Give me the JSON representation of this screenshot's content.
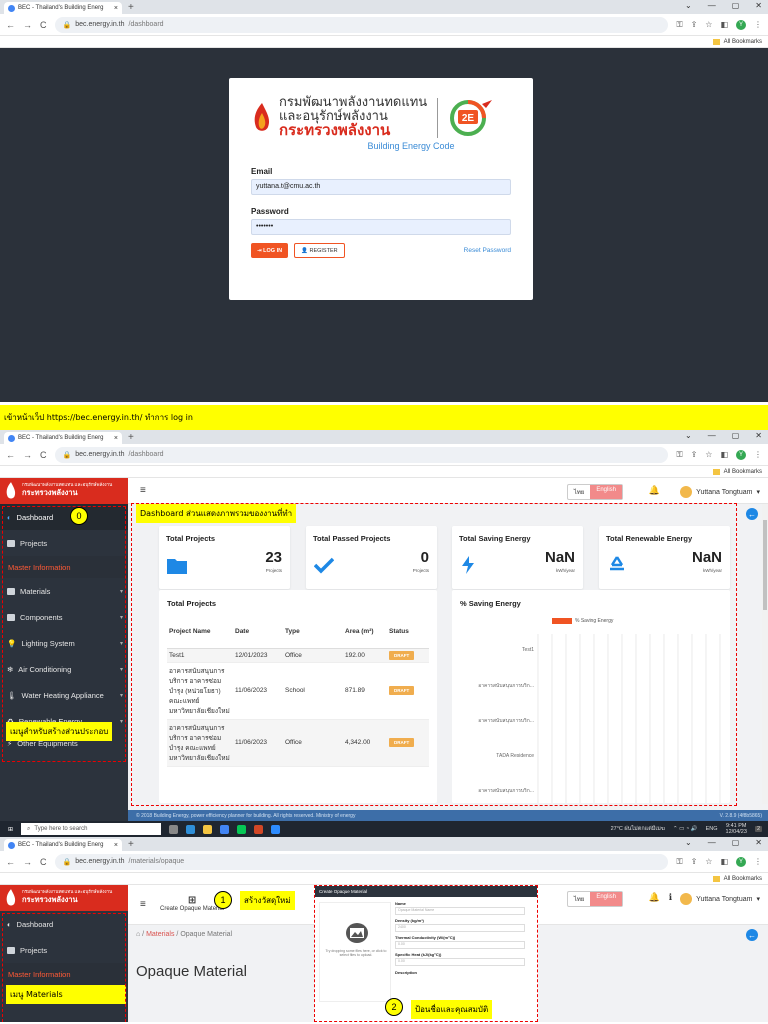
{
  "browser": {
    "tab_title": "BEC - Thailand's Building Energ",
    "tab_close": "×",
    "new_tab": "+",
    "win_controls": [
      "⌄",
      "—",
      "▢",
      "✕"
    ],
    "nav": [
      "←",
      "→",
      "C"
    ],
    "bookmarks": "All Bookmarks",
    "profile_letter": "Y"
  },
  "screen1": {
    "url_host": "bec.energy.in.th",
    "url_path": "/dashboard",
    "logo_line1": "กรมพัฒนาพลังงานทดแทน",
    "logo_line2": "และอนุรักษ์พลังงาน",
    "logo_line3": "กระทรวงพลังงาน",
    "badge": "2E",
    "app_name": "Building Energy Code",
    "email_label": "Email",
    "email_value": "yuttana.t@cmu.ac.th",
    "password_label": "Password",
    "password_value": "•••••••",
    "login_button": "LOG IN",
    "register_button": "REGISTER",
    "reset_link": "Reset Password"
  },
  "caption1": "เข้าหน้าเว็ป https://bec.energy.in.th/ ทำการ log in",
  "screen2": {
    "url_host": "bec.energy.in.th",
    "url_path": "/dashboard",
    "sidebar_logo_small": "กรมพัฒนาพลังงานทดแทน และอนุรักษ์พลังงาน",
    "sidebar_logo_big": "กระทรวงพลังงาน",
    "menu": [
      {
        "label": "Dashboard"
      },
      {
        "label": "Projects"
      },
      {
        "label": "Master Information"
      },
      {
        "label": "Materials"
      },
      {
        "label": "Components"
      },
      {
        "label": "Lighting System"
      },
      {
        "label": "Air Conditioning"
      },
      {
        "label": "Water Heating Appliance"
      },
      {
        "label": "Renewable Energy"
      },
      {
        "label": "Other Equipments"
      }
    ],
    "step_badge": "0",
    "sidebar_note": "เมนูสำหรับสร้างส่วนประกอบ",
    "lang_th": "ไทย",
    "lang_en": "English",
    "user_name": "Yuttana Tongtuam",
    "dashboard_note": "Dashboard ส่วนแสดงภาพรวมของงานที่ทำ",
    "stats": [
      {
        "title": "Total Projects",
        "value": "23",
        "unit": "Projects"
      },
      {
        "title": "Total Passed Projects",
        "value": "0",
        "unit": "Projects"
      },
      {
        "title": "Total Saving Energy",
        "value": "NaN",
        "unit": "kWh/year"
      },
      {
        "title": "Total Renewable Energy",
        "value": "NaN",
        "unit": "kWh/year"
      }
    ],
    "projects_title": "Total Projects",
    "table_headers": [
      "Project Name",
      "Date",
      "Type",
      "Area (m²)",
      "Status"
    ],
    "rows": [
      {
        "name": "Test1",
        "date": "12/01/2023",
        "type": "Office",
        "area": "192.00",
        "status": "DRAFT"
      },
      {
        "name": "อาคารสนับสนุนการบริการ อาคารซ่อมบำรุง (หน่วยโยธา) คณะแพทย์ มหาวิทยาลัยเชียงใหม่",
        "date": "11/06/2023",
        "type": "School",
        "area": "871.89",
        "status": "DRAFT"
      },
      {
        "name": "อาคารสนับสนุนการบริการ อาคารซ่อมบำรุง คณะแพทย์ มหาวิทยาลัยเชียงใหม่",
        "date": "11/06/2023",
        "type": "Office",
        "area": "4,342.00",
        "status": "DRAFT"
      }
    ],
    "saving_title": "% Saving Energy",
    "legend": "% Saving Energy",
    "chart_labels": [
      "Test1",
      "อาคารสนับสนุนการบริก...",
      "อาคารสนับสนุนการบริก...",
      "TADA Residence",
      "อาคารสนับสนุนการบริก..."
    ],
    "footer": "© 2018 Building Energy, power efficiency planner for building. All rights reserved. Ministry of energy",
    "version": "V. 2.8.9 (4f8b5865)",
    "taskbar_search": "Type here to search",
    "weather": "27°C ฝนไม่ตกแต่มีเมฆ",
    "lang_tb": "ENG",
    "time": "9:41 PM",
    "date": "12/04/23",
    "notif_count": "2"
  },
  "screen3": {
    "url_host": "bec.energy.in.th",
    "url_path": "/materials/opaque",
    "create_label": "Create Opaque Material",
    "step1_badge": "1",
    "step1_note": "สร้างวัสดุใหม่",
    "breadcrumb_link": "Materials",
    "breadcrumb_current": "Opaque Material",
    "page_title": "Opaque Material",
    "menu_note": "เมนู Materials",
    "menu": [
      {
        "label": "Dashboard"
      },
      {
        "label": "Projects"
      },
      {
        "label": "Master Information"
      }
    ],
    "modal_title": "Create Opaque Material",
    "upload_text": "Try dropping some files here, or click to select files to upload.",
    "fields": [
      {
        "label": "Name",
        "placeholder": "Opaque Material Name"
      },
      {
        "label": "Density (kg/m³)",
        "placeholder": "2400"
      },
      {
        "label": "Thermal Conductivity (W/(m°C))",
        "placeholder": "0.00"
      },
      {
        "label": "Specific Heat (kJ/(kg°C))",
        "placeholder": "0.00"
      },
      {
        "label": "Description",
        "placeholder": ""
      }
    ],
    "step2_badge": "2",
    "step2_note": "ป้อนชื่อและคุณสมบัติ"
  }
}
